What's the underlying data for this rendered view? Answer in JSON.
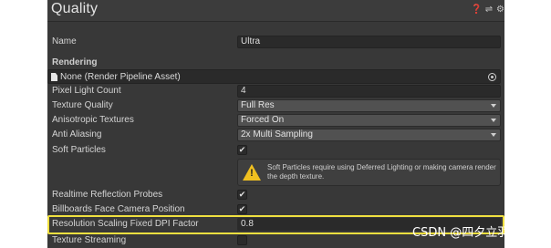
{
  "header": {
    "title": "Quality"
  },
  "fields": {
    "name_label": "Name",
    "name_value": "Ultra",
    "rendering_label": "Rendering",
    "render_pipeline_asset": "None (Render Pipeline Asset)",
    "pixel_light_count_label": "Pixel Light Count",
    "pixel_light_count_value": "4",
    "texture_quality_label": "Texture Quality",
    "texture_quality_value": "Full Res",
    "anisotropic_label": "Anisotropic Textures",
    "anisotropic_value": "Forced On",
    "anti_aliasing_label": "Anti Aliasing",
    "anti_aliasing_value": "2x Multi Sampling",
    "soft_particles_label": "Soft Particles",
    "soft_particles_checked": true,
    "soft_particles_warning": "Soft Particles require using Deferred Lighting or making camera render the depth texture.",
    "realtime_reflection_label": "Realtime Reflection Probes",
    "realtime_reflection_checked": true,
    "billboards_label": "Billboards Face Camera Position",
    "billboards_checked": true,
    "resolution_scaling_label": "Resolution Scaling Fixed DPI Factor",
    "resolution_scaling_value": "0.8",
    "texture_streaming_label": "Texture Streaming",
    "texture_streaming_checked": false
  },
  "checkmark": "✔",
  "icons": [
    "help-icon",
    "preset-icon",
    "settings-icon",
    "document-icon",
    "object-picker-icon",
    "warning-icon"
  ],
  "colors": {
    "highlight": "#f0e040",
    "warning": "#f0c020",
    "panel": "#383838"
  },
  "watermark": "CSDN @四夕立羽"
}
